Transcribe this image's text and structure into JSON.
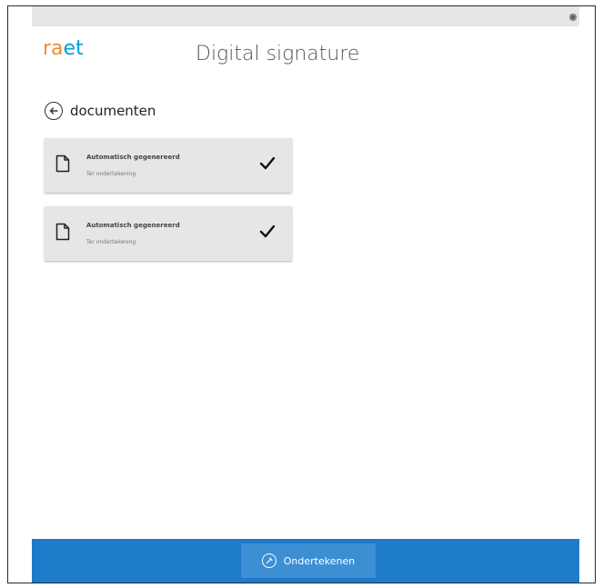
{
  "app": {
    "brand": {
      "part1": "ra",
      "part2": "e",
      "part3": "t"
    },
    "title": "Digital signature"
  },
  "nav": {
    "back_label": "documenten"
  },
  "documents": [
    {
      "title": "Automatisch gegenereerd",
      "status": "Ter ondertekening",
      "checked": true
    },
    {
      "title": "Automatisch gegenereerd",
      "status": "Ter ondertekening",
      "checked": true
    }
  ],
  "footer": {
    "sign_label": "Ondertekenen"
  },
  "colors": {
    "brand_orange": "#f28c2e",
    "brand_blue": "#00a0d6",
    "footer_blue": "#1e7bc9"
  },
  "icons": {
    "back": "arrow-left-circle-icon",
    "document": "document-icon",
    "check": "checkmark-icon",
    "sign": "sign-icon",
    "settings": "settings-dot-icon"
  }
}
